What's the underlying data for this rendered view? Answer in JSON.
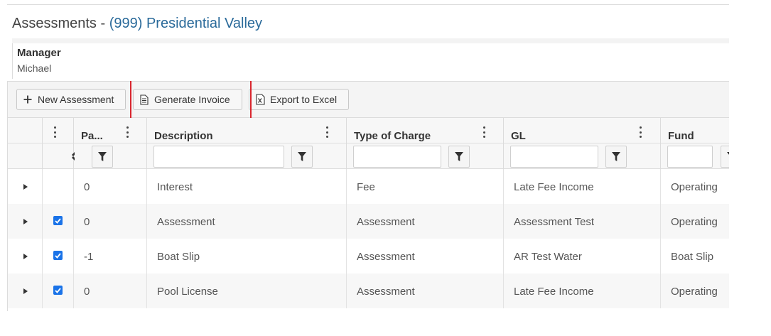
{
  "title": {
    "prefix": "Assessments",
    "separator": " - ",
    "association": "(999) Presidential Valley"
  },
  "info": {
    "label": "Manager",
    "value": "Michael"
  },
  "toolbar": {
    "new_label": "New Assessment",
    "generate_label": "Generate Invoice",
    "export_label": "Export to Excel"
  },
  "icons": {
    "new": "plus-icon",
    "generate": "document-icon",
    "export": "excel-icon",
    "column_menu": "kebab-icon",
    "filter": "filter-icon",
    "expander": "caret-right-icon",
    "checkbox": "checkbox-checked-icon"
  },
  "colors": {
    "link": "#2a6a9a",
    "highlight": "#d9262e",
    "checkbox": "#1a73e8"
  },
  "grid": {
    "columns": [
      "Pa...",
      "Description",
      "Type of Charge",
      "GL",
      "Fund"
    ],
    "rows": [
      {
        "checked": false,
        "pa": "0",
        "description": "Interest",
        "type": "Fee",
        "gl": "Late Fee Income",
        "fund": "Operating"
      },
      {
        "checked": true,
        "pa": "0",
        "description": "Assessment",
        "type": "Assessment",
        "gl": "Assessment Test",
        "fund": "Operating"
      },
      {
        "checked": true,
        "pa": "-1",
        "description": "Boat Slip",
        "type": "Assessment",
        "gl": "AR Test Water",
        "fund": "Boat Slip"
      },
      {
        "checked": true,
        "pa": "0",
        "description": "Pool License",
        "type": "Assessment",
        "gl": "Late Fee Income",
        "fund": "Operating"
      }
    ]
  }
}
